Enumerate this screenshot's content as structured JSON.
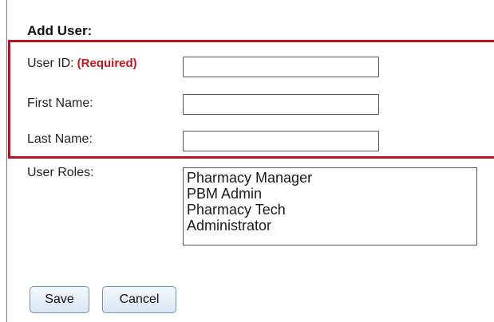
{
  "form": {
    "title": "Add User:",
    "fields": {
      "user_id": {
        "label": "User ID:",
        "required_text": "(Required)",
        "value": ""
      },
      "first_name": {
        "label": "First Name:",
        "value": ""
      },
      "last_name": {
        "label": "Last Name:",
        "value": ""
      }
    },
    "roles": {
      "label": "User Roles:",
      "options": [
        "Pharmacy Manager",
        "PBM Admin",
        "Pharmacy Tech",
        "Administrator"
      ]
    },
    "buttons": {
      "save": "Save",
      "cancel": "Cancel"
    }
  },
  "colors": {
    "highlight_border": "#b8121b",
    "required_text": "#c0161f",
    "button_border": "#6c8fb6"
  }
}
